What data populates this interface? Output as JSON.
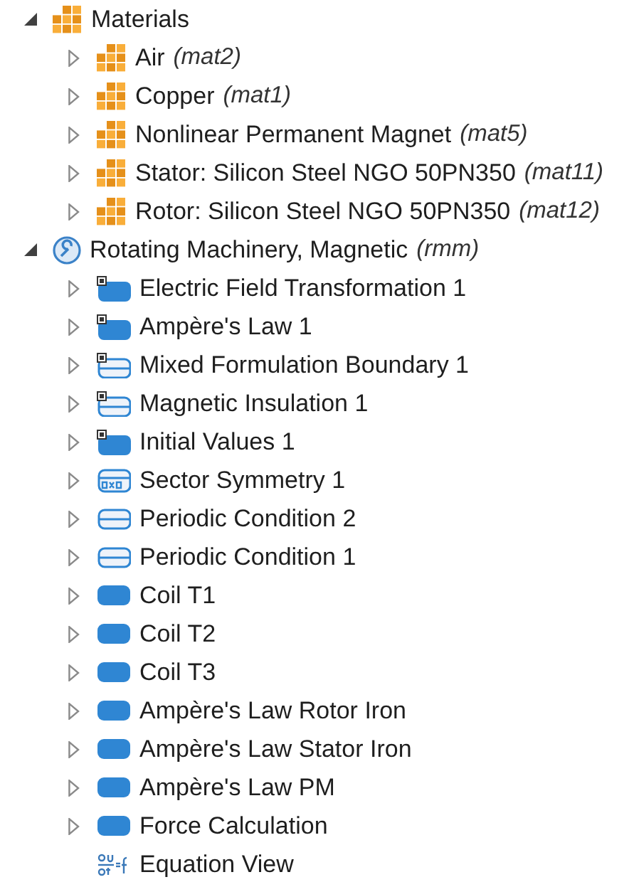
{
  "tree": [
    {
      "label": "Materials",
      "kind": "material",
      "expanded": true,
      "children": [
        {
          "label": "Air",
          "tag": "(mat2)",
          "kind": "material",
          "expanded": false
        },
        {
          "label": "Copper",
          "tag": "(mat1)",
          "kind": "material",
          "expanded": false
        },
        {
          "label": "Nonlinear Permanent Magnet",
          "tag": "(mat5)",
          "kind": "material",
          "expanded": false
        },
        {
          "label": "Stator: Silicon Steel NGO 50PN350",
          "tag": "(mat11)",
          "kind": "material",
          "expanded": false
        },
        {
          "label": "Rotor: Silicon Steel NGO 50PN350",
          "tag": "(mat12)",
          "kind": "material",
          "expanded": false
        }
      ]
    },
    {
      "label": "Rotating Machinery, Magnetic",
      "tag": "(rmm)",
      "kind": "physics",
      "expanded": true,
      "children": [
        {
          "label": "Electric Field Transformation 1",
          "kind": "domain_default",
          "expanded": false
        },
        {
          "label": "Ampère's Law 1",
          "kind": "domain_default",
          "expanded": false
        },
        {
          "label": "Mixed Formulation Boundary 1",
          "kind": "boundary_default",
          "expanded": false
        },
        {
          "label": "Magnetic Insulation 1",
          "kind": "boundary_default",
          "expanded": false
        },
        {
          "label": "Initial Values 1",
          "kind": "domain_default",
          "expanded": false
        },
        {
          "label": "Sector Symmetry 1",
          "kind": "sector",
          "expanded": false
        },
        {
          "label": "Periodic Condition 2",
          "kind": "boundary",
          "expanded": false
        },
        {
          "label": "Periodic Condition 1",
          "kind": "boundary",
          "expanded": false
        },
        {
          "label": "Coil T1",
          "kind": "domain",
          "expanded": false
        },
        {
          "label": "Coil T2",
          "kind": "domain",
          "expanded": false
        },
        {
          "label": "Coil T3",
          "kind": "domain",
          "expanded": false
        },
        {
          "label": "Ampère's Law Rotor Iron",
          "kind": "domain",
          "expanded": false
        },
        {
          "label": "Ampère's Law Stator Iron",
          "kind": "domain",
          "expanded": false
        },
        {
          "label": "Ampère's Law PM",
          "kind": "domain",
          "expanded": false
        },
        {
          "label": "Force Calculation",
          "kind": "domain",
          "expanded": false
        },
        {
          "label": "Equation View",
          "kind": "equation"
        }
      ]
    }
  ]
}
